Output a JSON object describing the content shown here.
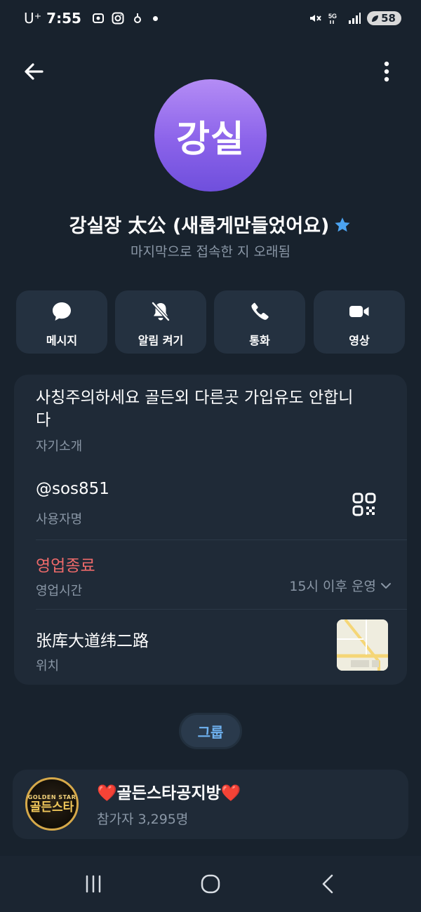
{
  "status_bar": {
    "carrier": "U⁺",
    "time": "7:55",
    "battery": "58"
  },
  "header": {
    "back_icon": "arrow-left-icon",
    "more_icon": "more-vertical-icon"
  },
  "profile": {
    "avatar_text": "강실",
    "name": "강실장 太公 (새롭게만들었어요)",
    "last_seen": "마지막으로 접속한 지 오래됨",
    "accent_color": "#8b63ea"
  },
  "actions": [
    {
      "label": "메시지",
      "icon": "message-icon"
    },
    {
      "label": "알림 켜기",
      "icon": "bell-off-icon"
    },
    {
      "label": "통화",
      "icon": "phone-icon"
    },
    {
      "label": "영상",
      "icon": "video-icon"
    }
  ],
  "info": {
    "bio": "사칭주의하세요 골든외 다른곳 가입유도 안합니다",
    "bio_label": "자기소개",
    "username": "@sos851",
    "username_label": "사용자명",
    "hours_status": "영업종료",
    "hours_label": "영업시간",
    "hours_value": "15시 이후 운영",
    "location": "张库大道纬二路",
    "location_label": "위치",
    "hours_status_color": "#ee6a6a"
  },
  "groups": {
    "chip_label": "그룹",
    "items": [
      {
        "title": "❤️골든스타공지방❤️",
        "members": "참가자 3,295명",
        "avatar_top": "GOLDEN STAR",
        "avatar_main": "골든스타"
      }
    ]
  }
}
